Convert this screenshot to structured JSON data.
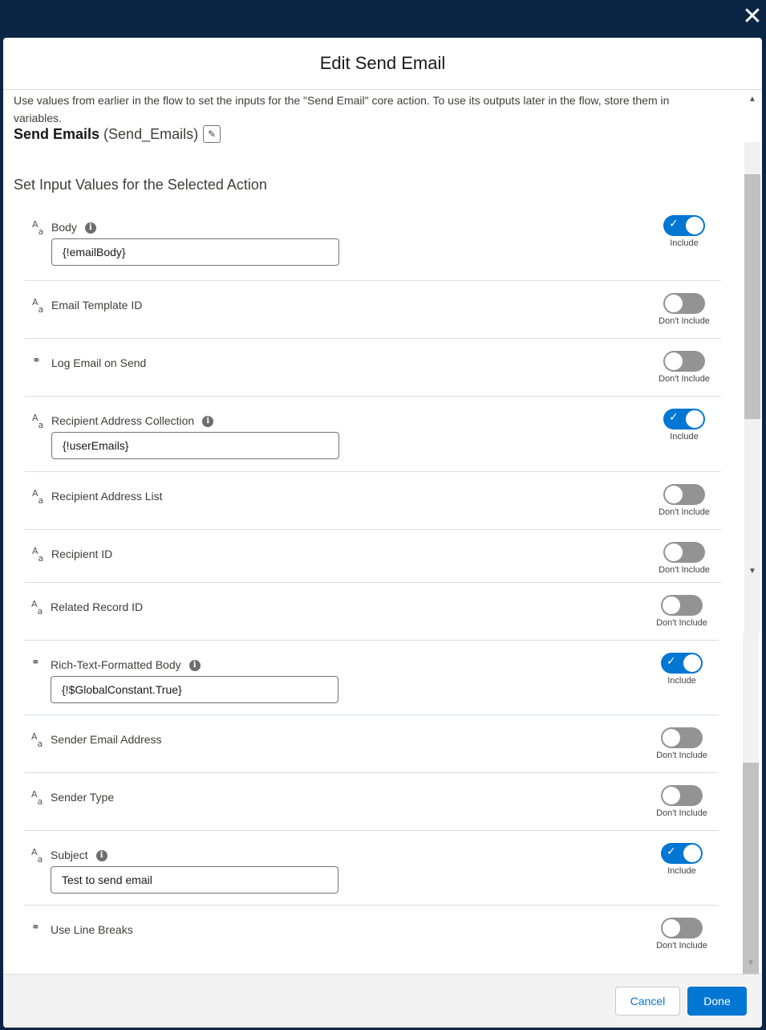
{
  "window": {
    "close_label": "✕"
  },
  "modal": {
    "title": "Edit Send Email",
    "intro": "Use values from earlier in the flow to set the inputs for the \"Send Email\" core action. To use its outputs later in the flow, store them in variables.",
    "action_label": "Send Emails",
    "action_api_name": "(Send_Emails)",
    "section_title": "Set Input Values for the Selected Action"
  },
  "fields": [
    {
      "label": "Body",
      "type_icon": "text-type-icon",
      "info": true,
      "value": "{!emailBody}",
      "toggle": "on",
      "toggle_text": "Include"
    },
    {
      "label": "Email Template ID",
      "type_icon": "text-type-icon",
      "info": false,
      "value": null,
      "toggle": "off",
      "toggle_text": "Don't Include"
    },
    {
      "label": "Log Email on Send",
      "type_icon": "boolean-type-icon",
      "info": false,
      "value": null,
      "toggle": "off",
      "toggle_text": "Don't Include"
    },
    {
      "label": "Recipient Address Collection",
      "type_icon": "text-type-icon",
      "info": true,
      "value": "{!userEmails}",
      "toggle": "on",
      "toggle_text": "Include"
    },
    {
      "label": "Recipient Address List",
      "type_icon": "text-type-icon",
      "info": false,
      "value": null,
      "toggle": "off",
      "toggle_text": "Don't Include"
    },
    {
      "label": "Recipient ID",
      "type_icon": "text-type-icon",
      "info": false,
      "value": null,
      "toggle": "off",
      "toggle_text": "Don't Include"
    },
    {
      "label": "Related Record ID",
      "type_icon": "text-type-icon",
      "info": false,
      "value": null,
      "toggle": "off",
      "toggle_text": "Don't Include"
    },
    {
      "label": "Rich-Text-Formatted Body",
      "type_icon": "boolean-type-icon",
      "info": true,
      "value": "{!$GlobalConstant.True}",
      "toggle": "on",
      "toggle_text": "Include"
    },
    {
      "label": "Sender Email Address",
      "type_icon": "text-type-icon",
      "info": false,
      "value": null,
      "toggle": "off",
      "toggle_text": "Don't Include"
    },
    {
      "label": "Sender Type",
      "type_icon": "text-type-icon",
      "info": false,
      "value": null,
      "toggle": "off",
      "toggle_text": "Don't Include"
    },
    {
      "label": "Subject",
      "type_icon": "text-type-icon",
      "info": true,
      "value": "Test to send email",
      "toggle": "on",
      "toggle_text": "Include"
    },
    {
      "label": "Use Line Breaks",
      "type_icon": "boolean-type-icon",
      "info": false,
      "value": null,
      "toggle": "off",
      "toggle_text": "Don't Include"
    }
  ],
  "footer": {
    "cancel_label": "Cancel",
    "done_label": "Done"
  },
  "colors": {
    "brand": "#0176d3",
    "header_bg": "#0b2545",
    "toggle_off": "#939393"
  }
}
